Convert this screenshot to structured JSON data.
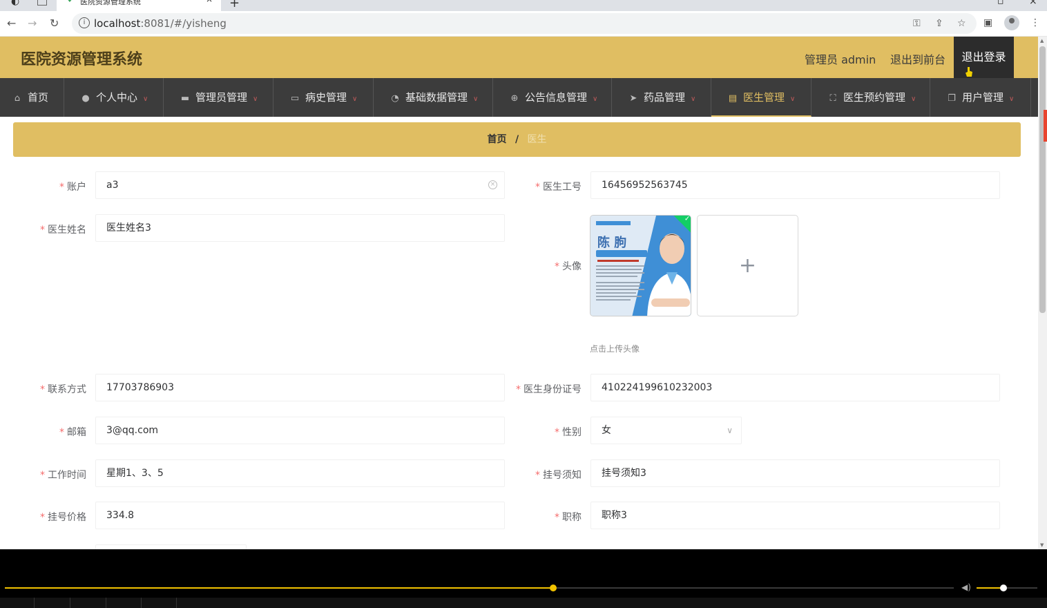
{
  "browser": {
    "tab_title": "医院资源管理系统",
    "url_host": "localhost",
    "url_rest": ":8081/#/yisheng"
  },
  "header": {
    "title": "医院资源管理系统",
    "user_label": "管理员 admin",
    "front_link": "退出到前台",
    "logout": "退出登录"
  },
  "menu": [
    {
      "label": "首页",
      "icon": "home-icon"
    },
    {
      "label": "个人中心",
      "icon": "user-icon"
    },
    {
      "label": "管理员管理",
      "icon": "briefcase-icon"
    },
    {
      "label": "病史管理",
      "icon": "chat-icon"
    },
    {
      "label": "基础数据管理",
      "icon": "dashboard-icon"
    },
    {
      "label": "公告信息管理",
      "icon": "globe-icon"
    },
    {
      "label": "药品管理",
      "icon": "send-icon"
    },
    {
      "label": "医生管理",
      "icon": "clipboard-icon"
    },
    {
      "label": "医生预约管理",
      "icon": "fullscreen-icon"
    },
    {
      "label": "用户管理",
      "icon": "copy-icon"
    }
  ],
  "active_menu": "医生管理",
  "breadcrumb": {
    "home": "首页",
    "separator": "/",
    "current": "医生"
  },
  "form": {
    "account_label": "账户",
    "account_value": "a3",
    "doctor_no_label": "医生工号",
    "doctor_no_value": "16456952563745",
    "doctor_name_label": "医生姓名",
    "doctor_name_value": "医生姓名3",
    "avatar_label": "头像",
    "avatar_tip": "点击上传头像",
    "avatar_plus": "+",
    "phone_label": "联系方式",
    "phone_value": "17703786903",
    "id_card_label": "医生身份证号",
    "id_card_value": "410224199610232003",
    "email_label": "邮箱",
    "email_value": "3@qq.com",
    "gender_label": "性别",
    "gender_value": "女",
    "work_time_label": "工作时间",
    "work_time_value": "星期1、3、5",
    "notice_label": "挂号须知",
    "notice_value": "挂号须知3",
    "price_label": "挂号价格",
    "price_value": "334.8",
    "title_label": "职称",
    "title_value": "职称3"
  },
  "avatar_image": {
    "name_text": "陈 朐"
  },
  "player": {
    "progress": 0.578,
    "volume": 0.44
  },
  "colors": {
    "header": "#e0be62",
    "menu": "#3c3c3c",
    "accent": "#e0be62",
    "required": "#f56c6c"
  }
}
